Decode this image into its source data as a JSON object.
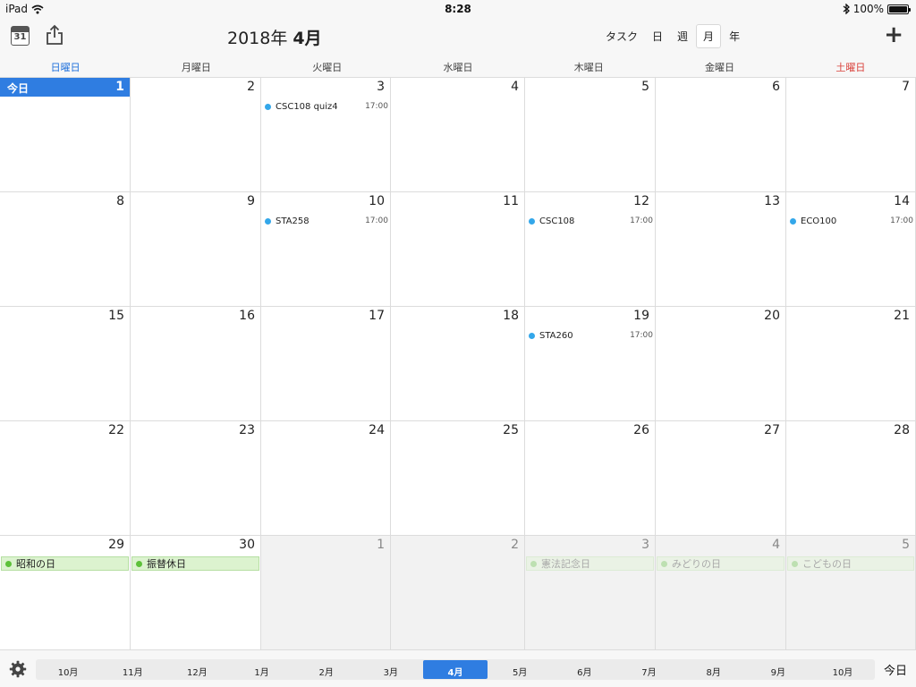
{
  "status": {
    "device": "iPad",
    "time": "8:28",
    "battery": "100%"
  },
  "toolbar": {
    "calendar_icon_day": "31",
    "title_year": "2018年",
    "title_month": "4月",
    "view_tabs": [
      {
        "label": "タスク",
        "active": false
      },
      {
        "label": "日",
        "active": false
      },
      {
        "label": "週",
        "active": false
      },
      {
        "label": "月",
        "active": true
      },
      {
        "label": "年",
        "active": false
      }
    ],
    "add_label": "+"
  },
  "weekdays": [
    "日曜日",
    "月曜日",
    "火曜日",
    "水曜日",
    "木曜日",
    "金曜日",
    "土曜日"
  ],
  "colors": {
    "accent": "#2f7de1",
    "sunday": "#1e6fdb",
    "saturday": "#d9403a",
    "event_dot": "#33a7ea",
    "holiday_dot": "#5dc13a"
  },
  "today_label": "今日",
  "weeks": [
    [
      {
        "day": "1",
        "today": true
      },
      {
        "day": "2"
      },
      {
        "day": "3",
        "event": {
          "name": "CSC108 quiz4",
          "time": "17:00"
        }
      },
      {
        "day": "4"
      },
      {
        "day": "5"
      },
      {
        "day": "6"
      },
      {
        "day": "7"
      }
    ],
    [
      {
        "day": "8"
      },
      {
        "day": "9"
      },
      {
        "day": "10",
        "event": {
          "name": "STA258",
          "time": "17:00"
        }
      },
      {
        "day": "11"
      },
      {
        "day": "12",
        "event": {
          "name": "CSC108",
          "time": "17:00"
        }
      },
      {
        "day": "13"
      },
      {
        "day": "14",
        "event": {
          "name": "ECO100",
          "time": "17:00"
        }
      }
    ],
    [
      {
        "day": "15"
      },
      {
        "day": "16"
      },
      {
        "day": "17"
      },
      {
        "day": "18"
      },
      {
        "day": "19",
        "event": {
          "name": "STA260",
          "time": "17:00"
        }
      },
      {
        "day": "20"
      },
      {
        "day": "21"
      }
    ],
    [
      {
        "day": "22"
      },
      {
        "day": "23"
      },
      {
        "day": "24"
      },
      {
        "day": "25"
      },
      {
        "day": "26"
      },
      {
        "day": "27"
      },
      {
        "day": "28"
      }
    ],
    [
      {
        "day": "29",
        "holiday": "昭和の日"
      },
      {
        "day": "30",
        "holiday": "振替休日"
      },
      {
        "day": "1",
        "other": true
      },
      {
        "day": "2",
        "other": true
      },
      {
        "day": "3",
        "other": true,
        "holiday": "憲法記念日"
      },
      {
        "day": "4",
        "other": true,
        "holiday": "みどりの日"
      },
      {
        "day": "5",
        "other": true,
        "holiday": "こどもの日"
      }
    ]
  ],
  "bottom": {
    "months": [
      {
        "label": "10月",
        "active": false
      },
      {
        "label": "11月",
        "active": false
      },
      {
        "label": "12月",
        "active": false
      },
      {
        "label": "1月",
        "active": false
      },
      {
        "label": "2月",
        "active": false
      },
      {
        "label": "3月",
        "active": false
      },
      {
        "label": "4月",
        "active": true
      },
      {
        "label": "5月",
        "active": false
      },
      {
        "label": "6月",
        "active": false
      },
      {
        "label": "7月",
        "active": false
      },
      {
        "label": "8月",
        "active": false
      },
      {
        "label": "9月",
        "active": false
      },
      {
        "label": "10月",
        "active": false
      }
    ],
    "today_button": "今日"
  }
}
